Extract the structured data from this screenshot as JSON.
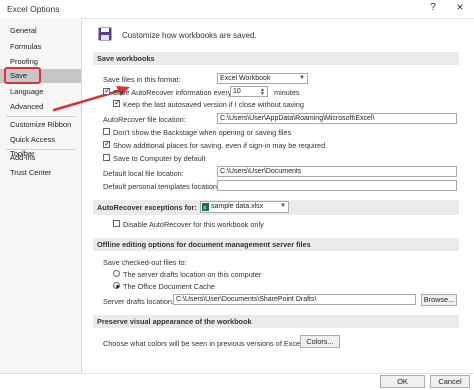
{
  "window": {
    "title": "Excel Options",
    "help_glyph": "?",
    "close_glyph": "×"
  },
  "sidebar": {
    "items": [
      {
        "label": "General"
      },
      {
        "label": "Formulas"
      },
      {
        "label": "Proofing"
      },
      {
        "label": "Save"
      },
      {
        "label": "Language"
      },
      {
        "label": "Advanced"
      },
      {
        "label": "Customize Ribbon"
      },
      {
        "label": "Quick Access Toolbar"
      },
      {
        "label": "Add-ins"
      },
      {
        "label": "Trust Center"
      }
    ],
    "selected": "Save",
    "highlight_color": "#d9343a"
  },
  "header": {
    "text": "Customize how workbooks are saved.",
    "icon": "floppy-disk-icon"
  },
  "save_workbooks": {
    "title": "Save workbooks",
    "format_label": "Save files in this format:",
    "format_value": "Excel Workbook",
    "autorecover_label": "Save AutoRecover information every",
    "autorecover_checked": true,
    "autorecover_minutes": "10",
    "minutes_label": "minutes",
    "keep_last_label": "Keep the last autosaved version if I close without saving",
    "keep_last_checked": true,
    "ar_location_label": "AutoRecover file location:",
    "ar_location_value": "C:\\Users\\User\\AppData\\Roaming\\Microsoft\\Excel\\",
    "backstage_label": "Don't show the Backstage when opening or saving files",
    "backstage_checked": false,
    "additional_places_label": "Show additional places for saving, even if sign-in may be required.",
    "additional_places_checked": true,
    "save_to_computer_label": "Save to Computer by default",
    "save_to_computer_checked": false,
    "default_local_label": "Default local file location:",
    "default_local_value": "C:\\Users\\User\\Documents",
    "default_templates_label": "Default personal templates location:",
    "default_templates_value": ""
  },
  "autorecover_exceptions": {
    "title": "AutoRecover exceptions for:",
    "workbook": "sample data.xlsx",
    "disable_label": "Disable AutoRecover for this workbook only",
    "disable_checked": false
  },
  "offline": {
    "title": "Offline editing options for document management server files",
    "save_checked_out_label": "Save checked-out files to:",
    "option1_label": "The server drafts location on this computer",
    "option1_selected": false,
    "option2_label": "The Office Document Cache",
    "option2_selected": true,
    "server_drafts_label": "Server drafts location:",
    "server_drafts_value": "C:\\Users\\User\\Documents\\SharePoint Drafts\\",
    "browse_label": "Browse..."
  },
  "preserve": {
    "title": "Preserve visual appearance of the workbook",
    "colors_label": "Choose what colors will be seen in previous versions of Excel:",
    "colors_button": "Colors..."
  },
  "footer": {
    "ok_label": "OK",
    "cancel_label": "Cancel"
  }
}
